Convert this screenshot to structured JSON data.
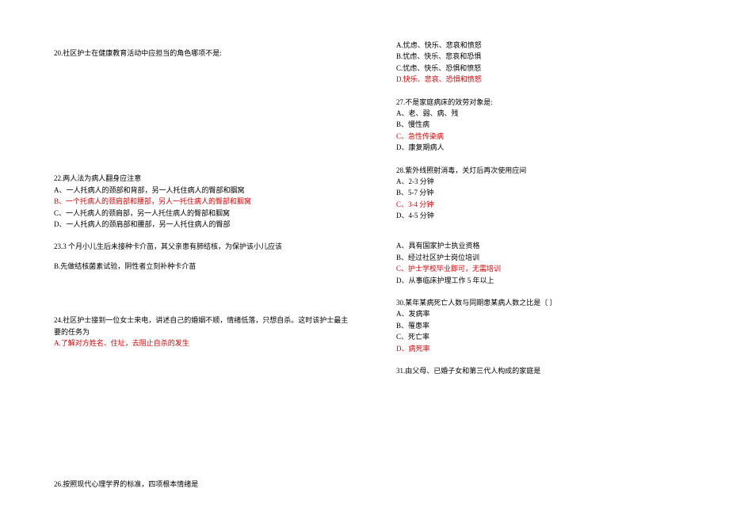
{
  "left": {
    "q20": {
      "text": "20.社区护士在健康教育活动中应担当的角色哪项不是:"
    },
    "q22": {
      "title": "22.两人法为病人翻身应注意",
      "a": "A、一人托病人的颈部和背部，另一人托住病人的臀部和腘窝",
      "b": "B、一个托病人的颈肩部和腰部，另人一托住病人的臀部和腘窝",
      "c": "C、一人托病人的颈肩部，另一人托住病人的臀部和腘窝",
      "d": "D、一人托病人的颈肩部和腰部，另一人托住病人的臀部"
    },
    "q23": {
      "text": "23.3 个月小儿生后未接种卡介苗，其父亲患有肺结核，为保护该小儿应该",
      "b": "B.先做结核菌素试验，阴性者立刻补种卡介苗"
    },
    "q24": {
      "text1": "24.社区护士接到一位女士来电，讲述自己的婚姻不顺，情绪低落，只想自杀。这时该护士最主",
      "text2": "要的任务为",
      "a": "A.了解对方姓名、住址，去阻止自杀的发生"
    },
    "q26": {
      "text": "26.按照现代心理学界的标准，四项根本情绪是"
    }
  },
  "right": {
    "q26opts": {
      "a": "A.忧虑、快乐、悲哀和愤怒",
      "b": "B.忧虑、快乐、悲哀和恐惧",
      "c": "C.忧虑、快乐、恐惧和愤怒",
      "d": "D.快乐、悲哀、恐惧和愤怒"
    },
    "q27": {
      "title": "27.不是家庭病床的效劳对象是:",
      "a": "A、老、弱、病、残",
      "b": "B、慢性病",
      "c": "C、急性传染病",
      "d": "D、康复期病人"
    },
    "q28": {
      "title": "28.紫外线照射消毒，关灯后再次使用应间",
      "a": "A、2-3 分钟",
      "b": "B、5-7 分钟",
      "c": "C、3-4 分钟",
      "d": "D、4-5 分钟"
    },
    "q29opts": {
      "a": "A、具有国家护士执业资格",
      "b": "B、经过社区护士岗位培训",
      "c": "C、护士学校毕业即可，无需培训",
      "d": "D、从事临床护理工作 5 年以上"
    },
    "q30": {
      "title": "30.某年某病死亡人数与同期患某病人数之比是〔  〕",
      "a": "A、发病率",
      "b": "B、罹患率",
      "c": "C、死亡率",
      "d": "D、病死率"
    },
    "q31": {
      "text": "31.由父母、已婚子女和第三代人构成的家庭是"
    }
  }
}
